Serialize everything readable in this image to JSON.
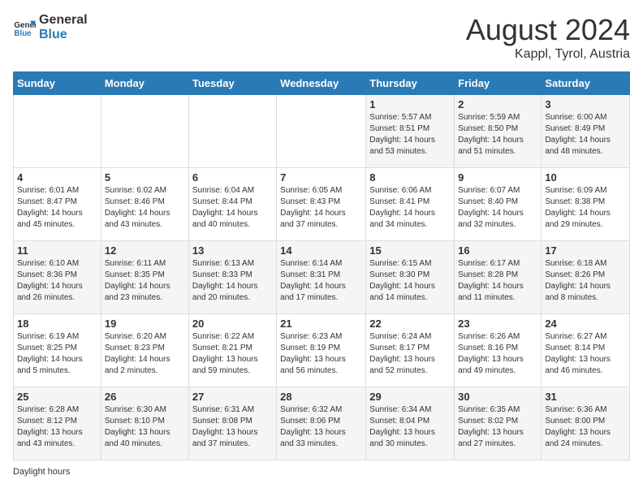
{
  "header": {
    "logo_general": "General",
    "logo_blue": "Blue",
    "title": "August 2024",
    "location": "Kappl, Tyrol, Austria"
  },
  "days_of_week": [
    "Sunday",
    "Monday",
    "Tuesday",
    "Wednesday",
    "Thursday",
    "Friday",
    "Saturday"
  ],
  "weeks": [
    [
      {
        "day": "",
        "info": ""
      },
      {
        "day": "",
        "info": ""
      },
      {
        "day": "",
        "info": ""
      },
      {
        "day": "",
        "info": ""
      },
      {
        "day": "1",
        "info": "Sunrise: 5:57 AM\nSunset: 8:51 PM\nDaylight: 14 hours\nand 53 minutes."
      },
      {
        "day": "2",
        "info": "Sunrise: 5:59 AM\nSunset: 8:50 PM\nDaylight: 14 hours\nand 51 minutes."
      },
      {
        "day": "3",
        "info": "Sunrise: 6:00 AM\nSunset: 8:49 PM\nDaylight: 14 hours\nand 48 minutes."
      }
    ],
    [
      {
        "day": "4",
        "info": "Sunrise: 6:01 AM\nSunset: 8:47 PM\nDaylight: 14 hours\nand 45 minutes."
      },
      {
        "day": "5",
        "info": "Sunrise: 6:02 AM\nSunset: 8:46 PM\nDaylight: 14 hours\nand 43 minutes."
      },
      {
        "day": "6",
        "info": "Sunrise: 6:04 AM\nSunset: 8:44 PM\nDaylight: 14 hours\nand 40 minutes."
      },
      {
        "day": "7",
        "info": "Sunrise: 6:05 AM\nSunset: 8:43 PM\nDaylight: 14 hours\nand 37 minutes."
      },
      {
        "day": "8",
        "info": "Sunrise: 6:06 AM\nSunset: 8:41 PM\nDaylight: 14 hours\nand 34 minutes."
      },
      {
        "day": "9",
        "info": "Sunrise: 6:07 AM\nSunset: 8:40 PM\nDaylight: 14 hours\nand 32 minutes."
      },
      {
        "day": "10",
        "info": "Sunrise: 6:09 AM\nSunset: 8:38 PM\nDaylight: 14 hours\nand 29 minutes."
      }
    ],
    [
      {
        "day": "11",
        "info": "Sunrise: 6:10 AM\nSunset: 8:36 PM\nDaylight: 14 hours\nand 26 minutes."
      },
      {
        "day": "12",
        "info": "Sunrise: 6:11 AM\nSunset: 8:35 PM\nDaylight: 14 hours\nand 23 minutes."
      },
      {
        "day": "13",
        "info": "Sunrise: 6:13 AM\nSunset: 8:33 PM\nDaylight: 14 hours\nand 20 minutes."
      },
      {
        "day": "14",
        "info": "Sunrise: 6:14 AM\nSunset: 8:31 PM\nDaylight: 14 hours\nand 17 minutes."
      },
      {
        "day": "15",
        "info": "Sunrise: 6:15 AM\nSunset: 8:30 PM\nDaylight: 14 hours\nand 14 minutes."
      },
      {
        "day": "16",
        "info": "Sunrise: 6:17 AM\nSunset: 8:28 PM\nDaylight: 14 hours\nand 11 minutes."
      },
      {
        "day": "17",
        "info": "Sunrise: 6:18 AM\nSunset: 8:26 PM\nDaylight: 14 hours\nand 8 minutes."
      }
    ],
    [
      {
        "day": "18",
        "info": "Sunrise: 6:19 AM\nSunset: 8:25 PM\nDaylight: 14 hours\nand 5 minutes."
      },
      {
        "day": "19",
        "info": "Sunrise: 6:20 AM\nSunset: 8:23 PM\nDaylight: 14 hours\nand 2 minutes."
      },
      {
        "day": "20",
        "info": "Sunrise: 6:22 AM\nSunset: 8:21 PM\nDaylight: 13 hours\nand 59 minutes."
      },
      {
        "day": "21",
        "info": "Sunrise: 6:23 AM\nSunset: 8:19 PM\nDaylight: 13 hours\nand 56 minutes."
      },
      {
        "day": "22",
        "info": "Sunrise: 6:24 AM\nSunset: 8:17 PM\nDaylight: 13 hours\nand 52 minutes."
      },
      {
        "day": "23",
        "info": "Sunrise: 6:26 AM\nSunset: 8:16 PM\nDaylight: 13 hours\nand 49 minutes."
      },
      {
        "day": "24",
        "info": "Sunrise: 6:27 AM\nSunset: 8:14 PM\nDaylight: 13 hours\nand 46 minutes."
      }
    ],
    [
      {
        "day": "25",
        "info": "Sunrise: 6:28 AM\nSunset: 8:12 PM\nDaylight: 13 hours\nand 43 minutes."
      },
      {
        "day": "26",
        "info": "Sunrise: 6:30 AM\nSunset: 8:10 PM\nDaylight: 13 hours\nand 40 minutes."
      },
      {
        "day": "27",
        "info": "Sunrise: 6:31 AM\nSunset: 8:08 PM\nDaylight: 13 hours\nand 37 minutes."
      },
      {
        "day": "28",
        "info": "Sunrise: 6:32 AM\nSunset: 8:06 PM\nDaylight: 13 hours\nand 33 minutes."
      },
      {
        "day": "29",
        "info": "Sunrise: 6:34 AM\nSunset: 8:04 PM\nDaylight: 13 hours\nand 30 minutes."
      },
      {
        "day": "30",
        "info": "Sunrise: 6:35 AM\nSunset: 8:02 PM\nDaylight: 13 hours\nand 27 minutes."
      },
      {
        "day": "31",
        "info": "Sunrise: 6:36 AM\nSunset: 8:00 PM\nDaylight: 13 hours\nand 24 minutes."
      }
    ]
  ],
  "footnote": "Daylight hours"
}
